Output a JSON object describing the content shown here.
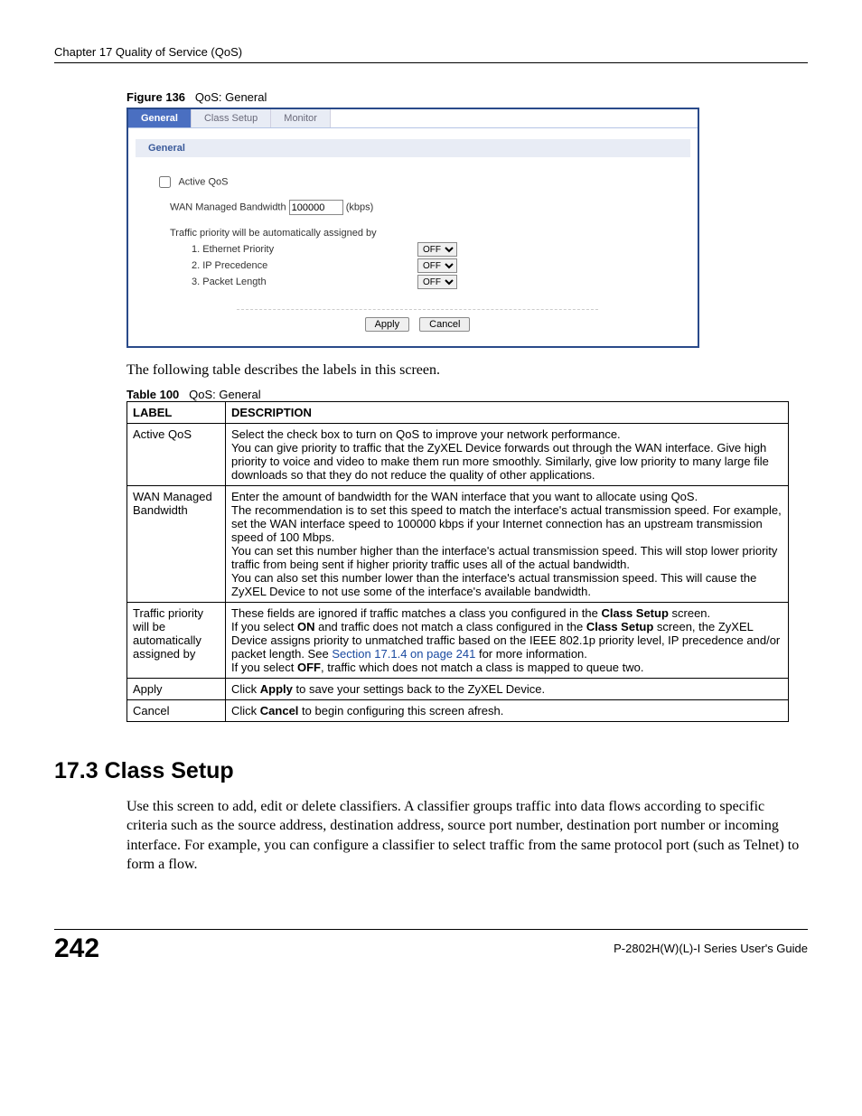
{
  "header": {
    "chapter": "Chapter 17 Quality of Service (QoS)"
  },
  "figure": {
    "num": "Figure 136",
    "title": "QoS: General"
  },
  "screenshot": {
    "tabs": {
      "general": "General",
      "class_setup": "Class Setup",
      "monitor": "Monitor"
    },
    "section_title": "General",
    "active_qos": "Active QoS",
    "wan_label_pre": "WAN Managed Bandwidth",
    "wan_value": "100000",
    "wan_label_post": "(kbps)",
    "priority_intro": "Traffic priority will be automatically assigned by",
    "priorities": {
      "p1": {
        "label": "1. Ethernet Priority",
        "value": "OFF"
      },
      "p2": {
        "label": "2. IP Precedence",
        "value": "OFF"
      },
      "p3": {
        "label": "3. Packet Length",
        "value": "OFF"
      }
    },
    "buttons": {
      "apply": "Apply",
      "cancel": "Cancel"
    }
  },
  "para1": "The following table describes the labels in this screen.",
  "table_caption": {
    "num": "Table 100",
    "title": "QoS: General"
  },
  "table": {
    "head": {
      "label": "LABEL",
      "desc": "DESCRIPTION"
    },
    "row1": {
      "label": "Active QoS",
      "d1": "Select the check box to turn on QoS to improve your network performance.",
      "d2": "You can give priority to traffic that the ZyXEL Device forwards out through the WAN interface. Give high priority to voice and video to make them run more smoothly. Similarly, give low priority to many large file downloads so that they do not reduce the quality of other applications."
    },
    "row2": {
      "label": "WAN Managed Bandwidth",
      "d1": "Enter the amount of bandwidth for the WAN interface that you want to allocate using QoS.",
      "d2": "The recommendation is to set this speed to match the interface's actual transmission speed. For example, set the WAN interface speed to 100000 kbps if your Internet connection has an upstream transmission speed of 100 Mbps.",
      "d3": "You can set this number higher than the interface's actual transmission speed. This will stop lower priority traffic from being sent if higher priority traffic uses all of the actual bandwidth.",
      "d4": "You can also set this number lower than the interface's actual transmission speed. This will cause the ZyXEL Device to not use some of the interface's available bandwidth."
    },
    "row3": {
      "label": "Traffic priority will be automatically assigned by",
      "d1a": "These fields are ignored if traffic matches a class you configured in the ",
      "d1b": "Class Setup",
      "d1c": " screen.",
      "d2a": "If you select ",
      "d2b": "ON",
      "d2c": " and traffic does not match a class configured in the ",
      "d2d": "Class Setup",
      "d2e": " screen, the ZyXEL Device assigns priority to unmatched traffic based on the IEEE 802.1p priority level, IP precedence and/or packet length. See ",
      "d2link": "Section 17.1.4 on page 241",
      "d2f": " for more information.",
      "d3a": "If you select ",
      "d3b": "OFF",
      "d3c": ", traffic which does not match a class is mapped to queue two."
    },
    "row4": {
      "label": "Apply",
      "d1a": "Click ",
      "d1b": "Apply",
      "d1c": " to save your settings back to the ZyXEL Device."
    },
    "row5": {
      "label": "Cancel",
      "d1a": "Click ",
      "d1b": "Cancel",
      "d1c": " to begin configuring this screen afresh."
    }
  },
  "section": {
    "heading": "17.3  Class Setup",
    "para": "Use this screen to add, edit or delete classifiers. A classifier groups traffic into data flows according to specific criteria such as the source address, destination address, source port number, destination port number or incoming interface. For example, you can configure a classifier to select traffic from the same protocol port (such as Telnet) to form a flow."
  },
  "footer": {
    "page": "242",
    "guide": "P-2802H(W)(L)-I Series User's Guide"
  }
}
